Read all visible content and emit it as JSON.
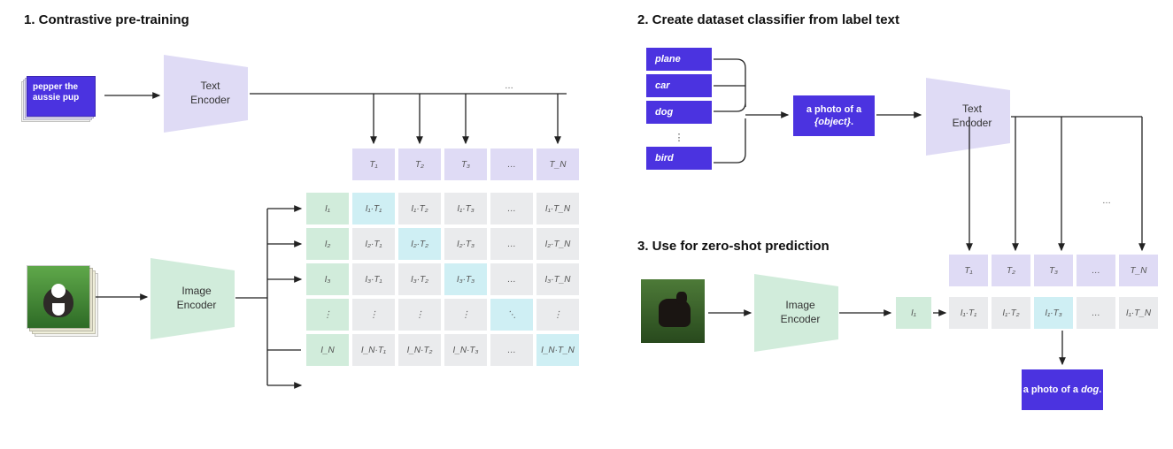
{
  "panel1": {
    "title": "1. Contrastive pre-training",
    "text_card": "pepper the aussie pup",
    "text_encoder": "Text\nEncoder",
    "image_encoder": "Image\nEncoder",
    "text_feats": [
      "T₁",
      "T₂",
      "T₃",
      "…",
      "T_N"
    ],
    "img_feats": [
      "I₁",
      "I₂",
      "I₃",
      "⋮",
      "I_N"
    ],
    "matrix": [
      [
        "I₁·T₁",
        "I₁·T₂",
        "I₁·T₃",
        "…",
        "I₁·T_N"
      ],
      [
        "I₂·T₁",
        "I₂·T₂",
        "I₂·T₃",
        "…",
        "I₂·T_N"
      ],
      [
        "I₃·T₁",
        "I₃·T₂",
        "I₃·T₃",
        "…",
        "I₃·T_N"
      ],
      [
        "⋮",
        "⋮",
        "⋮",
        "⋱",
        "⋮"
      ],
      [
        "I_N·T₁",
        "I_N·T₂",
        "I_N·T₃",
        "…",
        "I_N·T_N"
      ]
    ]
  },
  "panel2": {
    "title": "2. Create dataset classifier from label text",
    "labels": [
      "plane",
      "car",
      "dog",
      "bird"
    ],
    "vdots": "⋮",
    "prompt_prefix": "a photo of a ",
    "prompt_slot": "{object}",
    "prompt_suffix": ".",
    "text_encoder": "Text\nEncoder",
    "ell": "…"
  },
  "panel3": {
    "title": "3. Use for zero-shot prediction",
    "image_encoder": "Image\nEncoder",
    "img_feat": "I₁",
    "text_feats": [
      "T₁",
      "T₂",
      "T₃",
      "…",
      "T_N"
    ],
    "scores": [
      "I₁·T₁",
      "I₁·T₂",
      "I₁·T₃",
      "…",
      "I₁·T_N"
    ],
    "result_prefix": "a photo of a ",
    "result_obj": "dog",
    "result_suffix": "."
  },
  "colors": {
    "violet": "#4b33e0",
    "lav": "#dfdbf5",
    "mint": "#d1ecdb",
    "grid": "#eaebed",
    "diag": "#cfeff4"
  }
}
